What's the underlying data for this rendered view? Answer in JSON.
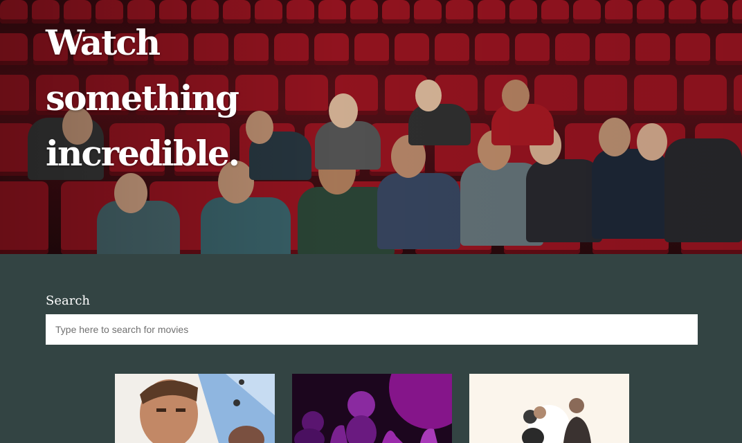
{
  "hero": {
    "title": "Watch something incredible."
  },
  "search": {
    "label": "Search",
    "placeholder": "Type here to search for movies",
    "value": ""
  },
  "movies": [
    {
      "poster": "action-movie-poster"
    },
    {
      "poster": "animated-movie-poster"
    },
    {
      "poster": "drama-movie-poster"
    }
  ],
  "colors": {
    "background": "#334443",
    "seat_red": "#a01522",
    "text": "#ffffff",
    "input_bg": "#ffffff"
  }
}
